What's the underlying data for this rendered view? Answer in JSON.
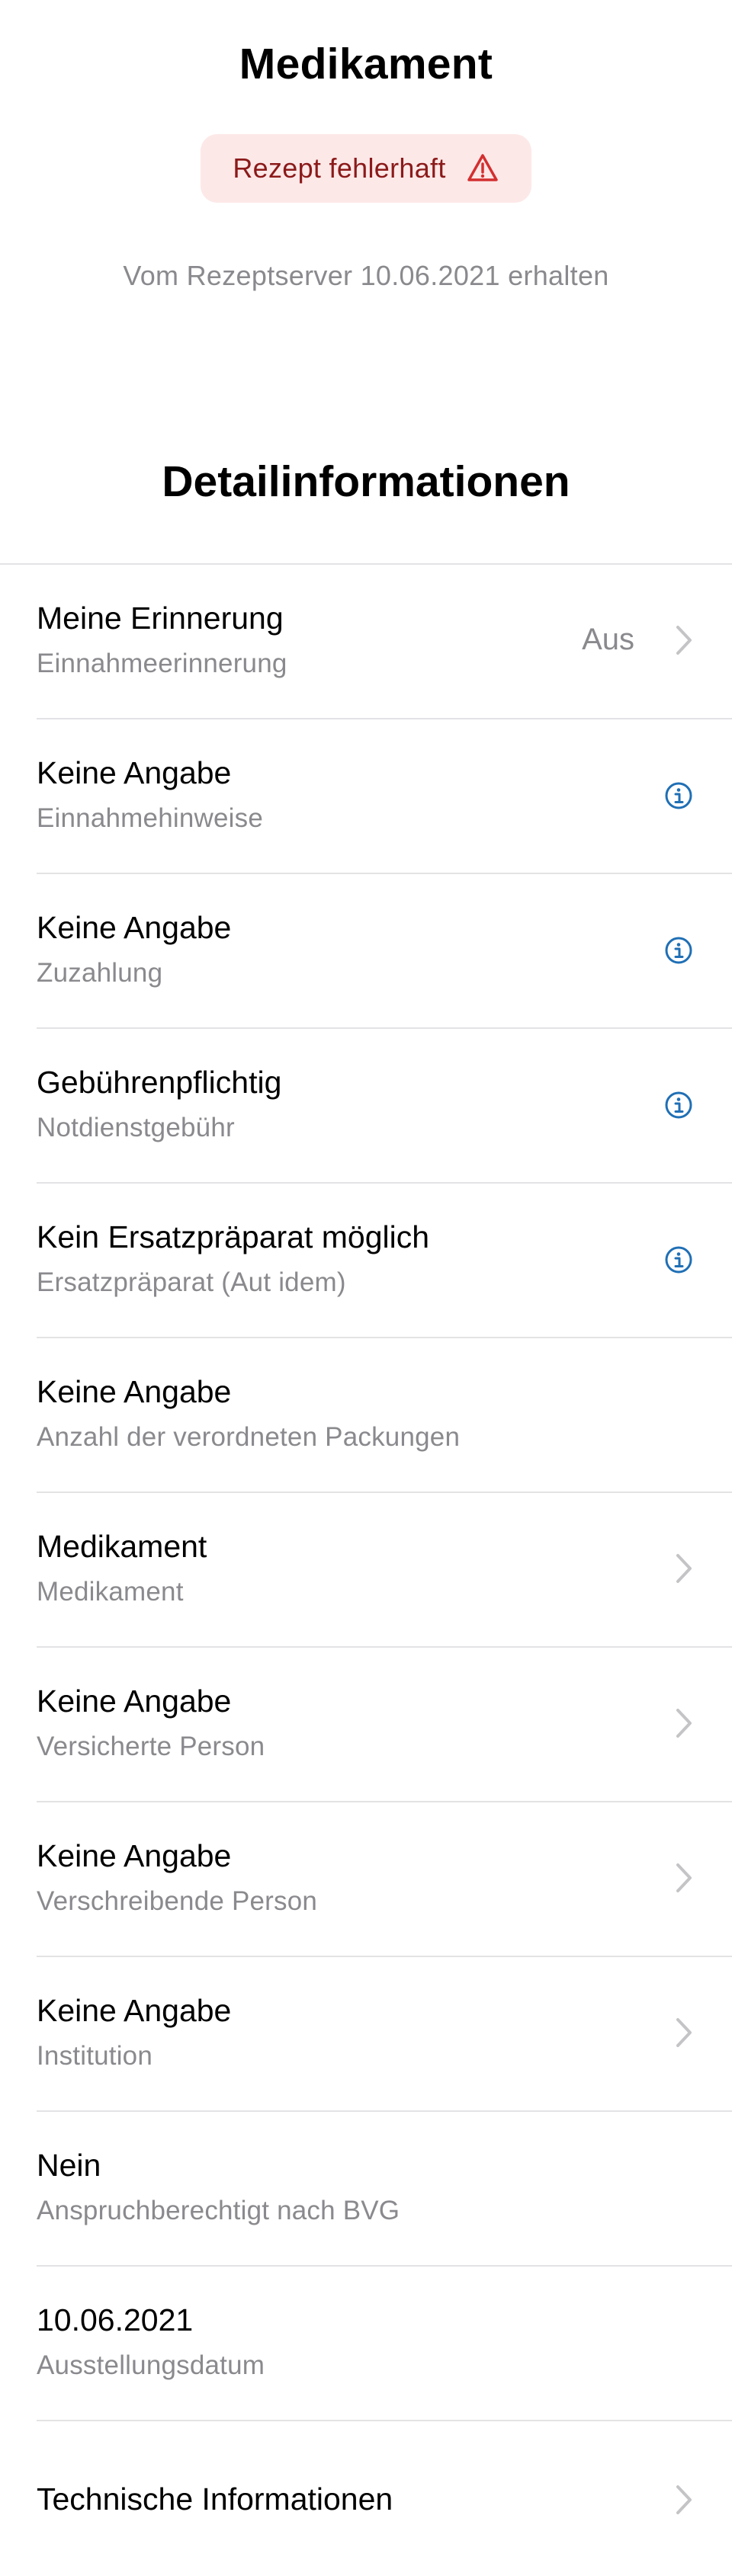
{
  "header": {
    "title": "Medikament",
    "status_badge": {
      "label": "Rezept fehlerhaft",
      "icon": "warning-triangle-icon",
      "background_color": "#fde8e8",
      "text_color": "#8b1a1a"
    },
    "received_text": "Vom Rezeptserver 10.06.2021 erhalten"
  },
  "details": {
    "section_title": "Detailinformationen",
    "rows": [
      {
        "title": "Meine Erinnerung",
        "subtitle": "Einnahmeerinnerung",
        "value": "Aus",
        "accessory": "chevron-right-icon"
      },
      {
        "title": "Keine Angabe",
        "subtitle": "Einnahmehinweise",
        "value": "",
        "accessory": "info-icon"
      },
      {
        "title": "Keine Angabe",
        "subtitle": "Zuzahlung",
        "value": "",
        "accessory": "info-icon"
      },
      {
        "title": "Gebührenpflichtig",
        "subtitle": "Notdienstgebühr",
        "value": "",
        "accessory": "info-icon"
      },
      {
        "title": "Kein Ersatzpräparat möglich",
        "subtitle": "Ersatzpräparat (Aut idem)",
        "value": "",
        "accessory": "info-icon"
      },
      {
        "title": "Keine Angabe",
        "subtitle": "Anzahl der verordneten Packungen",
        "value": "",
        "accessory": ""
      },
      {
        "title": "Medikament",
        "subtitle": "Medikament",
        "value": "",
        "accessory": "chevron-right-icon"
      },
      {
        "title": "Keine Angabe",
        "subtitle": "Versicherte Person",
        "value": "",
        "accessory": "chevron-right-icon"
      },
      {
        "title": "Keine Angabe",
        "subtitle": "Verschreibende Person",
        "value": "",
        "accessory": "chevron-right-icon"
      },
      {
        "title": "Keine Angabe",
        "subtitle": "Institution",
        "value": "",
        "accessory": "chevron-right-icon"
      },
      {
        "title": "Nein",
        "subtitle": "Anspruchberechtigt nach BVG",
        "value": "",
        "accessory": ""
      },
      {
        "title": "10.06.2021",
        "subtitle": "Ausstellungsdatum",
        "value": "",
        "accessory": ""
      },
      {
        "title": "Technische Informationen",
        "subtitle": "",
        "value": "",
        "accessory": "chevron-right-icon"
      }
    ]
  },
  "colors": {
    "info_icon": "#1f6fb5",
    "chevron": "#c4c4c7",
    "secondary_text": "#8a8a8e",
    "divider": "#e3e3e6"
  }
}
